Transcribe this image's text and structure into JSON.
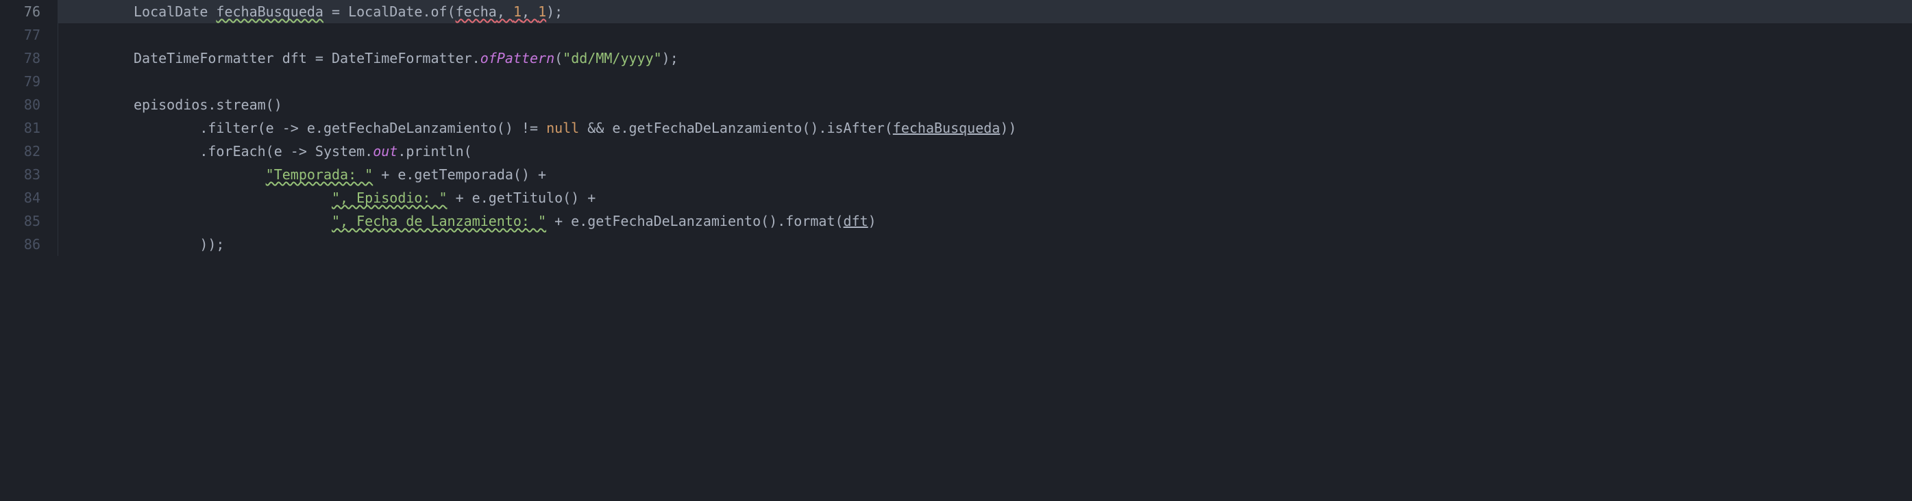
{
  "gutter": {
    "start": 76,
    "end": 86,
    "active": 76
  },
  "code": {
    "l76": {
      "t1": "LocalDate ",
      "t2": "fechaBusqueda",
      "t3": " = LocalDate.of(",
      "t4": "fecha",
      "t5": ", ",
      "t6": "1",
      "t7": ", ",
      "t8": "1",
      "t9": ");"
    },
    "l78": {
      "t1": "DateTimeFormatter dft = DateTimeFormatter.",
      "t2": "ofPattern",
      "t3": "(",
      "t4": "\"dd/MM/yyyy\"",
      "t5": ");"
    },
    "l80": {
      "t1": "episodios.stream()"
    },
    "l81": {
      "t1": ".filter(e -> e.getFechaDeLanzamiento() != ",
      "t2": "null",
      "t3": " && e.getFechaDeLanzamiento().isAfter(",
      "t4": "fechaBusqueda",
      "t5": "))"
    },
    "l82": {
      "t1": ".forEach(e -> System.",
      "t2": "out",
      "t3": ".println("
    },
    "l83": {
      "t1": "\"Temporada: \"",
      "t2": " + e.getTemporada() +"
    },
    "l84": {
      "t1": "\", Episodio: \"",
      "t2": " + e.getTitulo() +"
    },
    "l85": {
      "t1": "\", Fecha de Lanzamiento: \"",
      "t2": " + e.getFechaDeLanzamiento().format(",
      "t3": "dft",
      "t4": ")"
    },
    "l86": {
      "t1": "));"
    }
  }
}
